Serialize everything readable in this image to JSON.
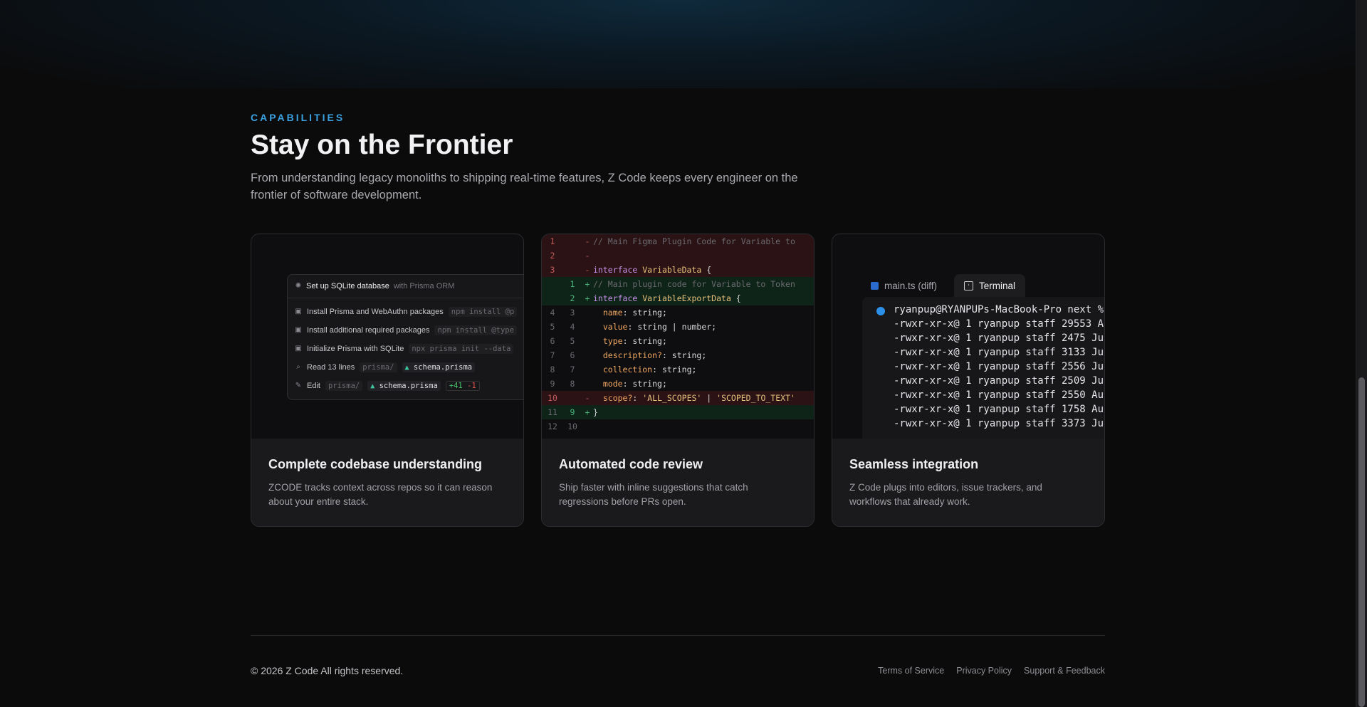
{
  "section": {
    "eyebrow": "CAPABILITIES",
    "title": "Stay on the Frontier",
    "lede": "From understanding legacy monoliths to shipping real-time features, Z Code keeps every engineer on the frontier of software development."
  },
  "cards": [
    {
      "title": "Complete codebase understanding",
      "description": "ZCODE tracks context across repos so it can reason about your entire stack.",
      "panel": {
        "header_strong": "Set up SQLite database",
        "header_muted": "with Prisma ORM",
        "rows": [
          {
            "icon": "square-icon",
            "label": "Install Prisma and WebAuthn packages",
            "cmd": "npm install @p"
          },
          {
            "icon": "square-icon",
            "label": "Install additional required packages",
            "cmd": "npm install @type"
          },
          {
            "icon": "square-icon",
            "label": "Initialize Prisma with SQLite",
            "cmd": "npx prisma init --data"
          },
          {
            "icon": "search-icon",
            "label": "Read 13 lines",
            "path": "prisma/",
            "file": "schema.prisma"
          },
          {
            "icon": "pencil-icon",
            "label": "Edit",
            "path": "prisma/",
            "file": "schema.prisma",
            "added": "+41",
            "removed": "-1"
          }
        ]
      }
    },
    {
      "title": "Automated code review",
      "description": "Ship faster with inline suggestions that catch regressions before PRs open.",
      "diff": [
        {
          "type": "del",
          "old": "1",
          "new": "",
          "sign": "-",
          "code": "// Main Figma Plugin Code for Variable to"
        },
        {
          "type": "del",
          "old": "2",
          "new": "",
          "sign": "-",
          "code": ""
        },
        {
          "type": "del",
          "old": "3",
          "new": "",
          "sign": "-",
          "code": "interface VariableData {"
        },
        {
          "type": "add",
          "old": "",
          "new": "1",
          "sign": "+",
          "code": "// Main plugin code for Variable to Token"
        },
        {
          "type": "add",
          "old": "",
          "new": "2",
          "sign": "+",
          "code": "interface VariableExportData {"
        },
        {
          "type": "ctx",
          "old": "4",
          "new": "3",
          "sign": "",
          "code": "  name: string;"
        },
        {
          "type": "ctx",
          "old": "5",
          "new": "4",
          "sign": "",
          "code": "  value: string | number;"
        },
        {
          "type": "ctx",
          "old": "6",
          "new": "5",
          "sign": "",
          "code": "  type: string;"
        },
        {
          "type": "ctx",
          "old": "7",
          "new": "6",
          "sign": "",
          "code": "  description?: string;"
        },
        {
          "type": "ctx",
          "old": "8",
          "new": "7",
          "sign": "",
          "code": "  collection: string;"
        },
        {
          "type": "ctx",
          "old": "9",
          "new": "8",
          "sign": "",
          "code": "  mode: string;"
        },
        {
          "type": "del",
          "old": "10",
          "new": "",
          "sign": "-",
          "code": "  scope?: 'ALL_SCOPES' | 'SCOPED_TO_TEXT'"
        },
        {
          "type": "add",
          "old": "11",
          "new": "9",
          "sign": "+",
          "code": "}"
        },
        {
          "type": "ctx",
          "old": "12",
          "new": "10",
          "sign": "",
          "code": ""
        }
      ]
    },
    {
      "title": "Seamless integration",
      "description": "Z Code plugs into editors, issue trackers, and workflows that already work.",
      "tabs": [
        {
          "label": "main.ts (diff)",
          "icon": "file-icon",
          "active": false
        },
        {
          "label": "Terminal",
          "icon": "terminal-icon",
          "active": true
        }
      ],
      "terminal": [
        "ryanpup@RYANPUPs-MacBook-Pro next %",
        "-rwxr-xr-x@ 1 ryanpup staff 29553 A",
        "-rwxr-xr-x@ 1 ryanpup staff 2475 Ju",
        "-rwxr-xr-x@ 1 ryanpup staff 3133 Ju",
        "-rwxr-xr-x@ 1 ryanpup staff 2556 Ju",
        "-rwxr-xr-x@ 1 ryanpup staff 2509 Ju",
        "-rwxr-xr-x@ 1 ryanpup staff 2550 Au",
        "-rwxr-xr-x@ 1 ryanpup staff 1758 Au",
        "-rwxr-xr-x@ 1 ryanpup staff 3373 Ju"
      ]
    }
  ],
  "footer": {
    "copyright": "© 2026 Z Code All rights reserved.",
    "links": [
      "Terms of Service",
      "Privacy Policy",
      "Support & Feedback"
    ]
  },
  "colors": {
    "accent": "#3aa0e0",
    "background": "#0b0b0c",
    "added": "#47c26a",
    "removed": "#e0564f"
  }
}
